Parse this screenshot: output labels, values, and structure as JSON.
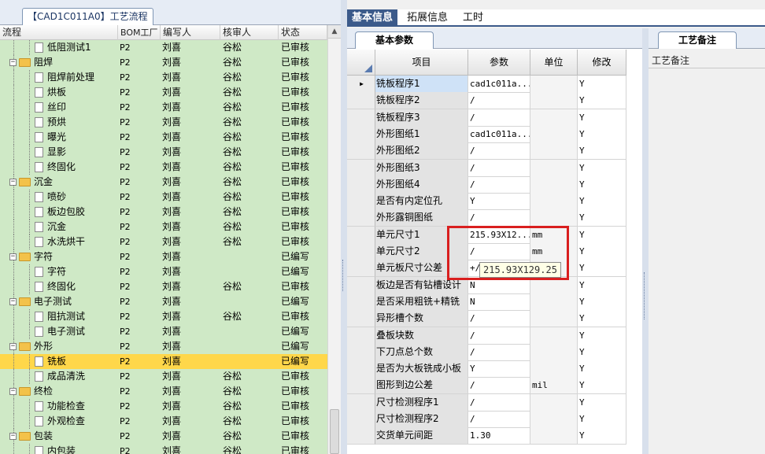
{
  "left_panel": {
    "tab_title": "【CAD1C011A0】工艺流程",
    "columns": [
      "流程",
      "BOM工厂",
      "编写人",
      "核审人",
      "状态"
    ],
    "rows": [
      {
        "name": "低阻测试1",
        "kind": "leaf",
        "bom": "P2",
        "writer": "刘喜",
        "reviewer": "谷松",
        "status": "已审核",
        "selected": false
      },
      {
        "name": "阻焊",
        "kind": "group",
        "bom": "P2",
        "writer": "刘喜",
        "reviewer": "谷松",
        "status": "已审核",
        "selected": false
      },
      {
        "name": "阻焊前处理",
        "kind": "leaf",
        "bom": "P2",
        "writer": "刘喜",
        "reviewer": "谷松",
        "status": "已审核",
        "selected": false
      },
      {
        "name": "烘板",
        "kind": "leaf",
        "bom": "P2",
        "writer": "刘喜",
        "reviewer": "谷松",
        "status": "已审核",
        "selected": false
      },
      {
        "name": "丝印",
        "kind": "leaf",
        "bom": "P2",
        "writer": "刘喜",
        "reviewer": "谷松",
        "status": "已审核",
        "selected": false
      },
      {
        "name": "预烘",
        "kind": "leaf",
        "bom": "P2",
        "writer": "刘喜",
        "reviewer": "谷松",
        "status": "已审核",
        "selected": false
      },
      {
        "name": "曝光",
        "kind": "leaf",
        "bom": "P2",
        "writer": "刘喜",
        "reviewer": "谷松",
        "status": "已审核",
        "selected": false
      },
      {
        "name": "显影",
        "kind": "leaf",
        "bom": "P2",
        "writer": "刘喜",
        "reviewer": "谷松",
        "status": "已审核",
        "selected": false
      },
      {
        "name": "终固化",
        "kind": "leaf",
        "bom": "P2",
        "writer": "刘喜",
        "reviewer": "谷松",
        "status": "已审核",
        "selected": false
      },
      {
        "name": "沉金",
        "kind": "group",
        "bom": "P2",
        "writer": "刘喜",
        "reviewer": "谷松",
        "status": "已审核",
        "selected": false
      },
      {
        "name": "喷砂",
        "kind": "leaf",
        "bom": "P2",
        "writer": "刘喜",
        "reviewer": "谷松",
        "status": "已审核",
        "selected": false
      },
      {
        "name": "板边包胶",
        "kind": "leaf",
        "bom": "P2",
        "writer": "刘喜",
        "reviewer": "谷松",
        "status": "已审核",
        "selected": false
      },
      {
        "name": "沉金",
        "kind": "leaf",
        "bom": "P2",
        "writer": "刘喜",
        "reviewer": "谷松",
        "status": "已审核",
        "selected": false
      },
      {
        "name": "水洗烘干",
        "kind": "leaf",
        "bom": "P2",
        "writer": "刘喜",
        "reviewer": "谷松",
        "status": "已审核",
        "selected": false
      },
      {
        "name": "字符",
        "kind": "group",
        "bom": "P2",
        "writer": "刘喜",
        "reviewer": "",
        "status": "已编写",
        "selected": false
      },
      {
        "name": "字符",
        "kind": "leaf",
        "bom": "P2",
        "writer": "刘喜",
        "reviewer": "",
        "status": "已编写",
        "selected": false
      },
      {
        "name": "终固化",
        "kind": "leaf",
        "bom": "P2",
        "writer": "刘喜",
        "reviewer": "谷松",
        "status": "已审核",
        "selected": false
      },
      {
        "name": "电子测试",
        "kind": "group",
        "bom": "P2",
        "writer": "刘喜",
        "reviewer": "",
        "status": "已编写",
        "selected": false
      },
      {
        "name": "阻抗测试",
        "kind": "leaf",
        "bom": "P2",
        "writer": "刘喜",
        "reviewer": "谷松",
        "status": "已审核",
        "selected": false
      },
      {
        "name": "电子测试",
        "kind": "leaf",
        "bom": "P2",
        "writer": "刘喜",
        "reviewer": "",
        "status": "已编写",
        "selected": false
      },
      {
        "name": "外形",
        "kind": "group",
        "bom": "P2",
        "writer": "刘喜",
        "reviewer": "",
        "status": "已编写",
        "selected": false
      },
      {
        "name": "铣板",
        "kind": "leaf",
        "bom": "P2",
        "writer": "刘喜",
        "reviewer": "",
        "status": "已编写",
        "selected": true
      },
      {
        "name": "成品清洗",
        "kind": "leaf",
        "bom": "P2",
        "writer": "刘喜",
        "reviewer": "谷松",
        "status": "已审核",
        "selected": false
      },
      {
        "name": "终检",
        "kind": "group",
        "bom": "P2",
        "writer": "刘喜",
        "reviewer": "谷松",
        "status": "已审核",
        "selected": false
      },
      {
        "name": "功能检查",
        "kind": "leaf",
        "bom": "P2",
        "writer": "刘喜",
        "reviewer": "谷松",
        "status": "已审核",
        "selected": false
      },
      {
        "name": "外观检查",
        "kind": "leaf",
        "bom": "P2",
        "writer": "刘喜",
        "reviewer": "谷松",
        "status": "已审核",
        "selected": false
      },
      {
        "name": "包装",
        "kind": "group",
        "bom": "P2",
        "writer": "刘喜",
        "reviewer": "谷松",
        "status": "已审核",
        "selected": false
      },
      {
        "name": "内包装",
        "kind": "leaf",
        "bom": "P2",
        "writer": "刘喜",
        "reviewer": "谷松",
        "status": "已审核",
        "selected": false
      }
    ]
  },
  "top_tabs": [
    "基本信息",
    "拓展信息",
    "工时"
  ],
  "sub_tab": "基本参数",
  "grid": {
    "columns": [
      "项目",
      "参数",
      "单位",
      "修改"
    ],
    "rows": [
      {
        "item": "铣板程序1",
        "param": "cad1c011a...",
        "unit": "",
        "mod": "Y"
      },
      {
        "item": "铣板程序2",
        "param": "/",
        "unit": "",
        "mod": "Y"
      },
      {
        "item": "铣板程序3",
        "param": "/",
        "unit": "",
        "mod": "Y"
      },
      {
        "item": "外形图纸1",
        "param": "cad1c011a...",
        "unit": "",
        "mod": "Y"
      },
      {
        "item": "外形图纸2",
        "param": "/",
        "unit": "",
        "mod": "Y"
      },
      {
        "item": "外形图纸3",
        "param": "/",
        "unit": "",
        "mod": "Y"
      },
      {
        "item": "外形图纸4",
        "param": "/",
        "unit": "",
        "mod": "Y"
      },
      {
        "item": "是否有内定位孔",
        "param": "Y",
        "unit": "",
        "mod": "Y"
      },
      {
        "item": "外形露铜图纸",
        "param": "/",
        "unit": "",
        "mod": "Y"
      },
      {
        "item": "单元尺寸1",
        "param": "215.93X12...",
        "unit": "mm",
        "mod": "Y"
      },
      {
        "item": "单元尺寸2",
        "param": "/",
        "unit": "mm",
        "mod": "Y"
      },
      {
        "item": "单元板尺寸公差",
        "param": "+/",
        "unit": "",
        "mod": "Y"
      },
      {
        "item": "板边是否有钻槽设计",
        "param": "N",
        "unit": "",
        "mod": "Y"
      },
      {
        "item": "是否采用粗铣+精铣",
        "param": "N",
        "unit": "",
        "mod": "Y"
      },
      {
        "item": "异形槽个数",
        "param": "/",
        "unit": "",
        "mod": "Y"
      },
      {
        "item": "叠板块数",
        "param": "/",
        "unit": "",
        "mod": "Y"
      },
      {
        "item": "下刀点总个数",
        "param": "/",
        "unit": "",
        "mod": "Y"
      },
      {
        "item": "是否为大板铣成小板",
        "param": "Y",
        "unit": "",
        "mod": "Y"
      },
      {
        "item": "图形到边公差",
        "param": "/",
        "unit": "mil",
        "mod": "Y"
      },
      {
        "item": "尺寸检测程序1",
        "param": "/",
        "unit": "",
        "mod": "Y"
      },
      {
        "item": "尺寸检测程序2",
        "param": "/",
        "unit": "",
        "mod": "Y"
      },
      {
        "item": "交货单元间距",
        "param": "1.30",
        "unit": "",
        "mod": "Y"
      }
    ]
  },
  "tooltip": "215.93X129.25",
  "notes_panel": {
    "tab": "工艺备注",
    "label": "工艺备注"
  },
  "colors": {
    "tree_bg": "#cfe9c6",
    "selected_row": "#ffd74a",
    "tab_active": "#3b5a8a",
    "highlight": "#d91f1f"
  }
}
